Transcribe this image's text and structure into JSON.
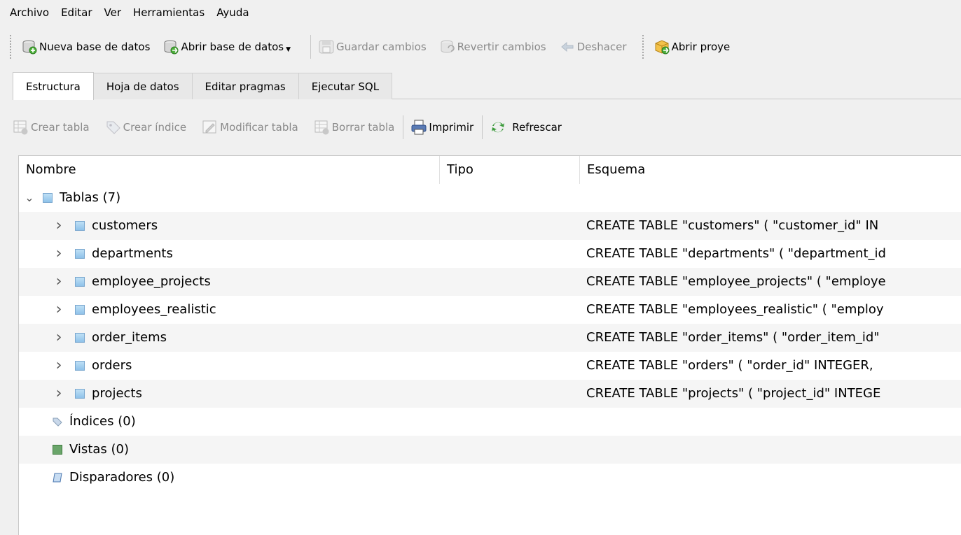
{
  "menu": [
    "Archivo",
    "Editar",
    "Ver",
    "Herramientas",
    "Ayuda"
  ],
  "toolbar": {
    "new_db": "Nueva base de datos",
    "open_db": "Abrir base de datos",
    "save": "Guardar cambios",
    "revert": "Revertir cambios",
    "undo": "Deshacer",
    "open_project": "Abrir proye"
  },
  "tabs": [
    "Estructura",
    "Hoja de datos",
    "Editar pragmas",
    "Ejecutar SQL"
  ],
  "structure_toolbar": {
    "create_table": "Crear tabla",
    "create_index": "Crear índice",
    "modify_table": "Modificar tabla",
    "delete_table": "Borrar tabla",
    "print": "Imprimir",
    "refresh": "Refrescar"
  },
  "tree": {
    "columns": [
      "Nombre",
      "Tipo",
      "Esquema"
    ],
    "tables_label": "Tablas (7)",
    "tables": [
      {
        "name": "customers",
        "schema": "CREATE TABLE \"customers\" ( \"customer_id\" IN"
      },
      {
        "name": "departments",
        "schema": "CREATE TABLE \"departments\" ( \"department_id"
      },
      {
        "name": "employee_projects",
        "schema": "CREATE TABLE \"employee_projects\" ( \"employe"
      },
      {
        "name": "employees_realistic",
        "schema": "CREATE TABLE \"employees_realistic\" ( \"employ"
      },
      {
        "name": "order_items",
        "schema": "CREATE TABLE \"order_items\" ( \"order_item_id\""
      },
      {
        "name": "orders",
        "schema": "CREATE TABLE \"orders\" ( \"order_id\" INTEGER,"
      },
      {
        "name": "projects",
        "schema": "CREATE TABLE \"projects\" ( \"project_id\" INTEGE"
      }
    ],
    "indices_label": "Índices (0)",
    "views_label": "Vistas (0)",
    "triggers_label": "Disparadores (0)"
  }
}
